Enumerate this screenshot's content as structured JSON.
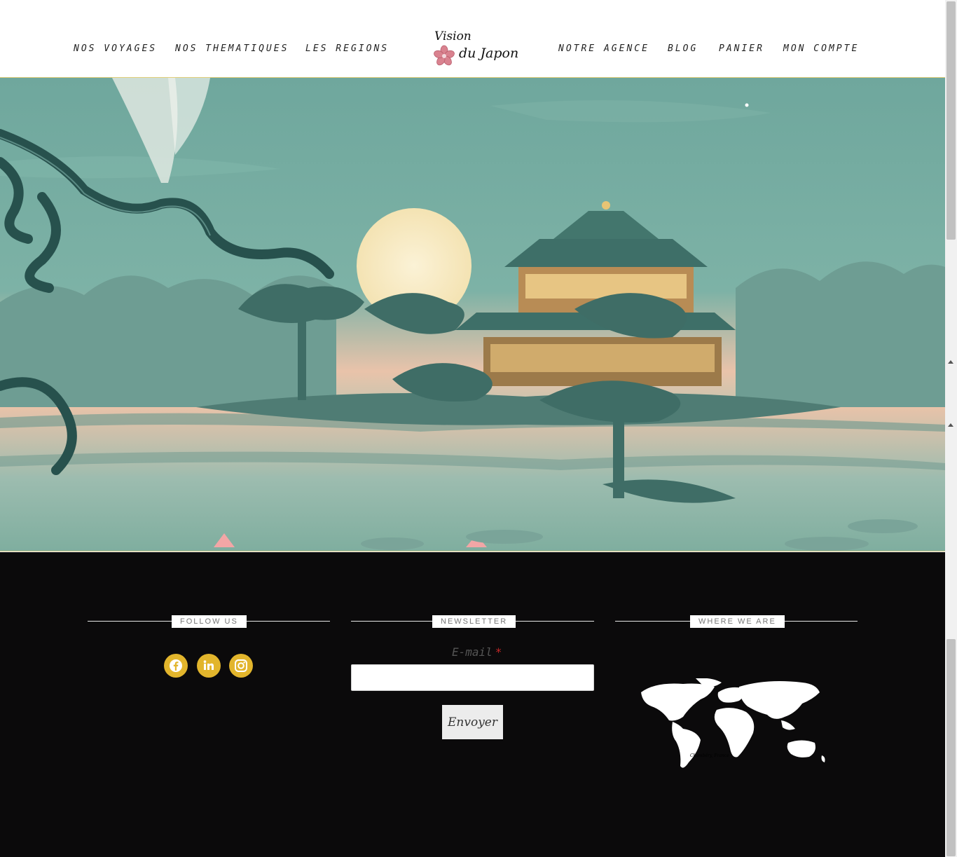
{
  "header": {
    "nav_left": [
      "NOS VOYAGES",
      "NOS THEMATIQUES",
      "LES REGIONS"
    ],
    "nav_right": [
      "NOTRE AGENCE",
      "BLOG",
      "PANIER",
      "MON COMPTE"
    ],
    "logo": {
      "line1": "Vision",
      "line2": "du Japon"
    }
  },
  "footer": {
    "follow": {
      "title": "FOLLOW US",
      "icons": [
        "facebook-icon",
        "linkedin-icon",
        "instagram-icon"
      ]
    },
    "newsletter": {
      "title": "NEWSLETTER",
      "email_label": "E-mail",
      "required_mark": "*",
      "email_value": "",
      "submit_label": "Envoyer"
    },
    "location": {
      "title": "WHERE WE ARE",
      "map_caption": "Chambéry, France"
    }
  },
  "colors": {
    "accent": "#e2b52c",
    "footer_bg": "#0b0a0b",
    "hero_teal": "#6fa79d"
  }
}
